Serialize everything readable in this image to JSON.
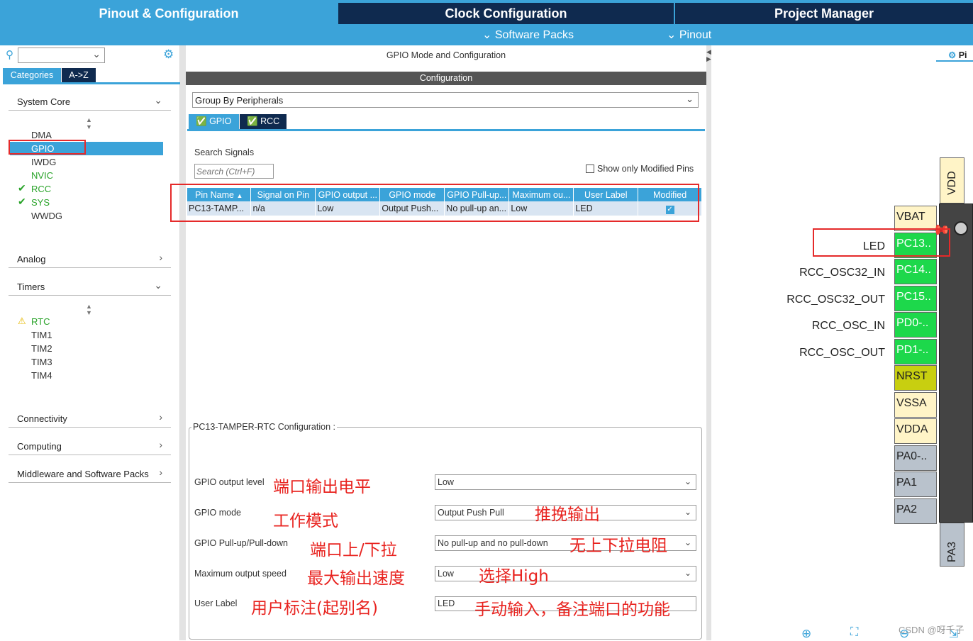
{
  "top_tabs": {
    "pinout": "Pinout & Configuration",
    "clock": "Clock Configuration",
    "project": "Project Manager"
  },
  "sub_menu": {
    "software_packs": "Software Packs",
    "pinout": "Pinout"
  },
  "left": {
    "tab_categories": "Categories",
    "tab_az": "A->Z",
    "system_core": {
      "label": "System Core",
      "items": [
        "DMA",
        "GPIO",
        "IWDG",
        "NVIC",
        "RCC",
        "SYS",
        "WWDG"
      ]
    },
    "analog": "Analog",
    "timers": {
      "label": "Timers",
      "items": [
        "RTC",
        "TIM1",
        "TIM2",
        "TIM3",
        "TIM4"
      ]
    },
    "connectivity": "Connectivity",
    "computing": "Computing",
    "middleware": "Middleware and Software Packs"
  },
  "middle": {
    "title": "GPIO Mode and Configuration",
    "config_header": "Configuration",
    "group_by": "Group By Peripherals",
    "tab_gpio": "GPIO",
    "tab_rcc": "RCC",
    "search_label": "Search Signals",
    "search_placeholder": "Search (Ctrl+F)",
    "show_modified": "Show only Modified Pins",
    "table": {
      "headers": [
        "Pin Name",
        "Signal on Pin",
        "GPIO output ...",
        "GPIO mode",
        "GPIO Pull-up...",
        "Maximum ou...",
        "User Label",
        "Modified"
      ],
      "row": [
        "PC13-TAMP...",
        "n/a",
        "Low",
        "Output Push...",
        "No pull-up an...",
        "Low",
        "LED"
      ]
    },
    "pin_config_title": "PC13-TAMPER-RTC Configuration :",
    "form": {
      "output_level_label": "GPIO output level",
      "output_level_value": "Low",
      "mode_label": "GPIO mode",
      "mode_value": "Output Push Pull",
      "pull_label": "GPIO Pull-up/Pull-down",
      "pull_value": "No pull-up and no pull-down",
      "speed_label": "Maximum output speed",
      "speed_value": "Low",
      "user_label_label": "User Label",
      "user_label_value": "LED"
    },
    "annotations": {
      "output_level": "端口输出电平",
      "mode": "工作模式",
      "pull": "端口上/下拉",
      "speed": "最大输出速度",
      "user_label": "用户标注(起别名)",
      "mode_value": "推挽输出",
      "pull_value": "无上下拉电阻",
      "speed_value": "选择High",
      "user_label_value": "手动输入，备注端口的功能"
    }
  },
  "right": {
    "pinout_view": "Pi",
    "vdd_top": "VDD",
    "pa3": "PA3",
    "pins": [
      {
        "name": "VBAT",
        "signal": ""
      },
      {
        "name": "PC13..",
        "signal": "LED"
      },
      {
        "name": "PC14..",
        "signal": "RCC_OSC32_IN"
      },
      {
        "name": "PC15..",
        "signal": "RCC_OSC32_OUT"
      },
      {
        "name": "PD0-..",
        "signal": "RCC_OSC_IN"
      },
      {
        "name": "PD1-..",
        "signal": "RCC_OSC_OUT"
      },
      {
        "name": "NRST",
        "signal": ""
      },
      {
        "name": "VSSA",
        "signal": ""
      },
      {
        "name": "VDDA",
        "signal": ""
      },
      {
        "name": "PA0-..",
        "signal": ""
      },
      {
        "name": "PA1",
        "signal": ""
      },
      {
        "name": "PA2",
        "signal": ""
      }
    ],
    "watermark": "CSDN @呀千子"
  },
  "colors": {
    "accent": "#3ba3d9",
    "dark_tab": "#0f2a4f",
    "pin_green": "#1dd84b",
    "annotation_red": "#e8231f"
  }
}
